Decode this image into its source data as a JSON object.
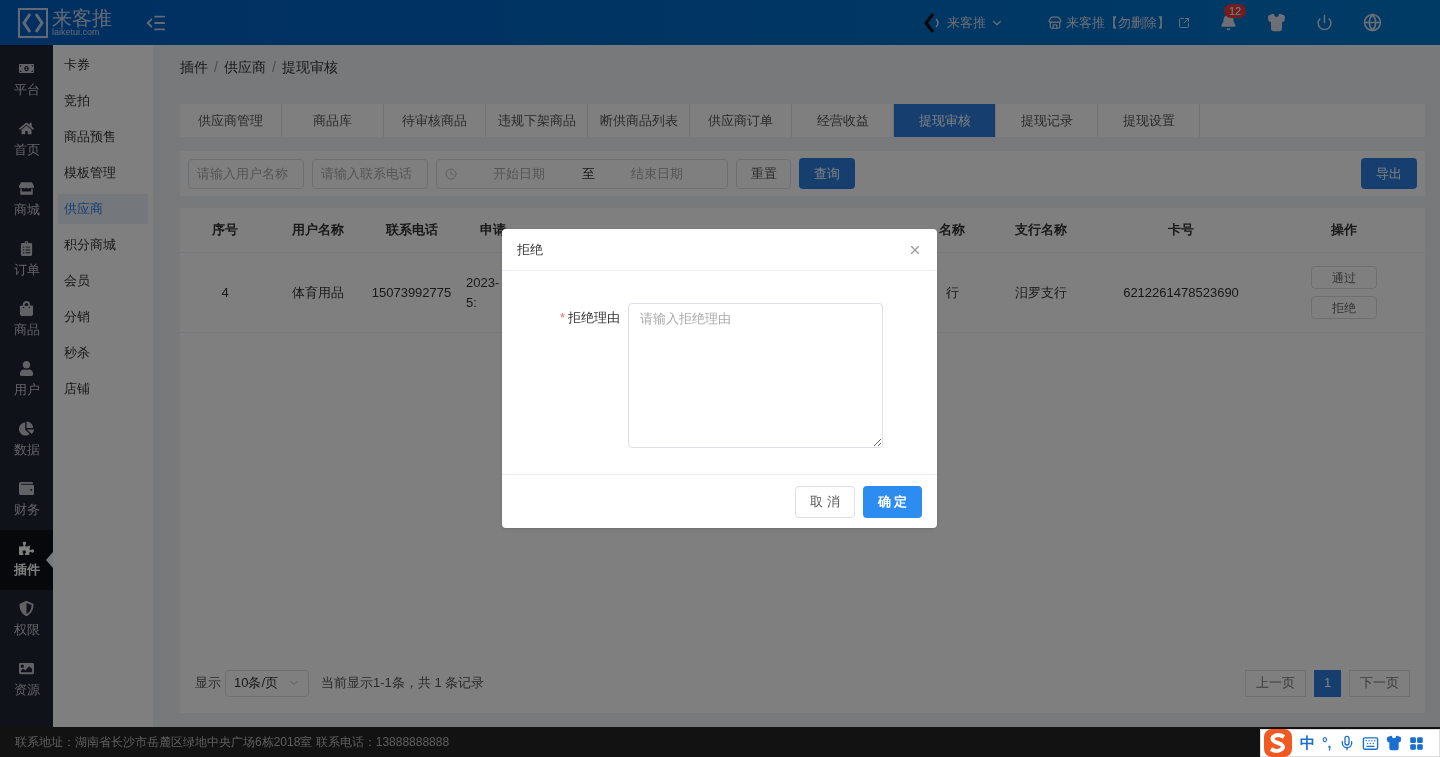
{
  "header": {
    "logo_text": "来客推",
    "logo_sub": "laiketui.com",
    "user": "来客推",
    "store": "来客推【勿删除】",
    "notification_count": "12"
  },
  "sidebar": {
    "items": [
      {
        "label": "平台",
        "selected": false
      },
      {
        "label": "首页",
        "selected": false
      },
      {
        "label": "商城",
        "selected": false
      },
      {
        "label": "订单",
        "selected": false
      },
      {
        "label": "商品",
        "selected": false
      },
      {
        "label": "用户",
        "selected": false
      },
      {
        "label": "数据",
        "selected": false
      },
      {
        "label": "财务",
        "selected": false
      },
      {
        "label": "插件",
        "selected": true
      },
      {
        "label": "权限",
        "selected": false
      },
      {
        "label": "资源",
        "selected": false
      }
    ]
  },
  "submenu": {
    "items": [
      {
        "label": "卡券",
        "selected": false
      },
      {
        "label": "竞拍",
        "selected": false
      },
      {
        "label": "商品预售",
        "selected": false
      },
      {
        "label": "模板管理",
        "selected": false
      },
      {
        "label": "供应商",
        "selected": true
      },
      {
        "label": "积分商城",
        "selected": false
      },
      {
        "label": "会员",
        "selected": false
      },
      {
        "label": "分销",
        "selected": false
      },
      {
        "label": "秒杀",
        "selected": false
      },
      {
        "label": "店铺",
        "selected": false
      }
    ]
  },
  "breadcrumb": {
    "items": [
      "插件",
      "供应商",
      "提现审核"
    ],
    "separator": "/"
  },
  "tabs": [
    {
      "label": "供应商管理",
      "selected": false
    },
    {
      "label": "商品库",
      "selected": false
    },
    {
      "label": "待审核商品",
      "selected": false
    },
    {
      "label": "违规下架商品",
      "selected": false
    },
    {
      "label": "断供商品列表",
      "selected": false
    },
    {
      "label": "供应商订单",
      "selected": false
    },
    {
      "label": "经营收益",
      "selected": false
    },
    {
      "label": "提现审核",
      "selected": true
    },
    {
      "label": "提现记录",
      "selected": false
    },
    {
      "label": "提现设置",
      "selected": false
    }
  ],
  "filters": {
    "user_placeholder": "请输入用户名称",
    "phone_placeholder": "请输入联系电话",
    "start_placeholder": "开始日期",
    "range_separator": "至",
    "end_placeholder": "结束日期",
    "reset": "重置",
    "search": "查询",
    "export": "导出"
  },
  "table": {
    "columns": [
      "序号",
      "用户名称",
      "联系电话",
      "申请",
      null,
      null,
      null,
      "名称",
      "支行名称",
      "卡号",
      "操作"
    ],
    "rows": [
      {
        "cells": [
          "4",
          "体育用品",
          "15073992775",
          [
            "2023-",
            "5:"
          ],
          null,
          null,
          null,
          "行",
          "汨罗支行",
          "6212261478523690"
        ],
        "actions": [
          "通过",
          "拒绝"
        ]
      }
    ]
  },
  "pagination": {
    "show_label": "显示",
    "page_size": "10条/页",
    "summary": "当前显示1-1条，共 1 条记录",
    "prev": "上一页",
    "pages": [
      {
        "label": "1",
        "selected": true
      }
    ],
    "next": "下一页"
  },
  "footer": "联系地址：湖南省长沙市岳麓区绿地中央广场6栋2018室 联系电话：13888888888",
  "ime": {
    "mode": "中",
    "punct": "°,"
  },
  "dialog": {
    "title": "拒绝",
    "field_label": "拒绝理由",
    "required_mark": "*",
    "placeholder": "请输入拒绝理由",
    "cancel": "取 消",
    "confirm": "确 定"
  }
}
